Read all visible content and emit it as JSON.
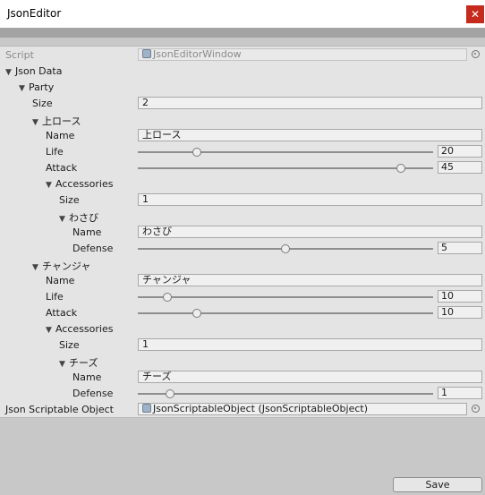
{
  "window": {
    "title": "JsonEditor",
    "close_glyph": "✕"
  },
  "script": {
    "label": "Script",
    "value": "JsonEditorWindow"
  },
  "json_data": {
    "label": "Json Data"
  },
  "party": {
    "label": "Party",
    "size_label": "Size",
    "size_value": "2"
  },
  "member1": {
    "header": "上ロース",
    "name_label": "Name",
    "name_value": "上ロース",
    "life_label": "Life",
    "life_value": "20",
    "life_fraction": 0.2,
    "attack_label": "Attack",
    "attack_value": "45",
    "attack_fraction": 0.89,
    "accessories_label": "Accessories",
    "acc_size_label": "Size",
    "acc_size_value": "1",
    "acc_header": "わさび",
    "acc_name_label": "Name",
    "acc_name_value": "わさび",
    "acc_defense_label": "Defense",
    "acc_defense_value": "5",
    "acc_defense_fraction": 0.5
  },
  "member2": {
    "header": "チャンジャ",
    "name_label": "Name",
    "name_value": "チャンジャ",
    "life_label": "Life",
    "life_value": "10",
    "life_fraction": 0.1,
    "attack_label": "Attack",
    "attack_value": "10",
    "attack_fraction": 0.2,
    "accessories_label": "Accessories",
    "acc_size_label": "Size",
    "acc_size_value": "1",
    "acc_header": "チーズ",
    "acc_name_label": "Name",
    "acc_name_value": "チーズ",
    "acc_defense_label": "Defense",
    "acc_defense_value": "1",
    "acc_defense_fraction": 0.11
  },
  "scriptable": {
    "label": "Json Scriptable Object",
    "value": "JsonScriptableObject (JsonScriptableObject)"
  },
  "footer": {
    "save_label": "Save"
  }
}
